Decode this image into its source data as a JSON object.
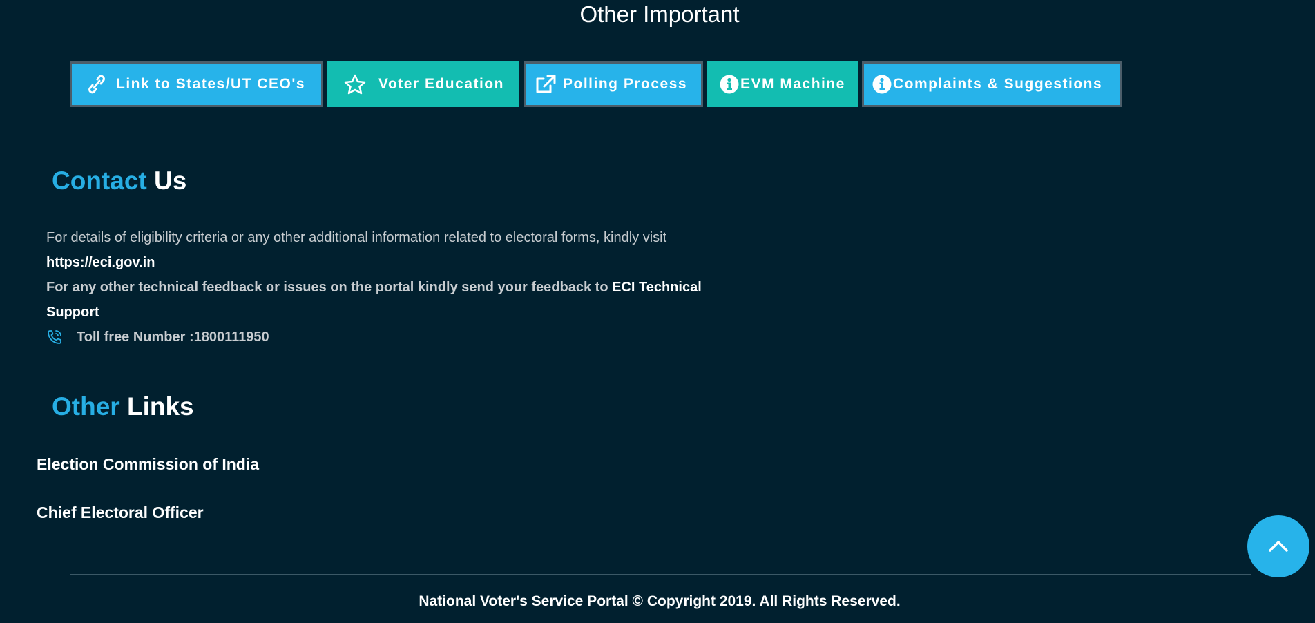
{
  "important": {
    "title": "Other Important",
    "buttons": [
      {
        "label": "Link to States/UT CEO's",
        "icon": "link-icon",
        "color": "#27b3ea"
      },
      {
        "label": "Voter Education",
        "icon": "star-icon",
        "color": "#13bdb1"
      },
      {
        "label": "Polling Process",
        "icon": "external-link-icon",
        "color": "#27b3ea"
      },
      {
        "label": "EVM Machine",
        "icon": "info-circle-icon",
        "color": "#13bdb1"
      },
      {
        "label": "Complaints & Suggestions",
        "icon": "info-circle-icon",
        "color": "#27b3ea"
      }
    ]
  },
  "contact": {
    "heading_accent": "Contact",
    "heading_rest": "Us",
    "line1": "For details of eligibility criteria or any other additional information related to electoral forms, kindly visit",
    "url": "https://eci.gov.in",
    "line2": "For any other technical feedback or issues on the portal kindly send your feedback to",
    "support_link_part1": "ECI Technical",
    "support_link_part2": "Support",
    "toll_free": "Toll free Number :1800111950",
    "phone_icon": "phone-icon"
  },
  "other_links": {
    "heading_accent": "Other",
    "heading_rest": "Links",
    "links": [
      "Election Commission of India",
      "Chief Electoral Officer"
    ]
  },
  "footer": {
    "copyright": "National Voter's Service Portal © Copyright 2019. All Rights Reserved."
  },
  "scroll_top": {
    "icon": "chevron-up-icon"
  },
  "colors": {
    "background": "#01202f",
    "accent_blue": "#27b3ea",
    "accent_teal": "#13bdb1",
    "heading_accent": "#27aee4"
  }
}
